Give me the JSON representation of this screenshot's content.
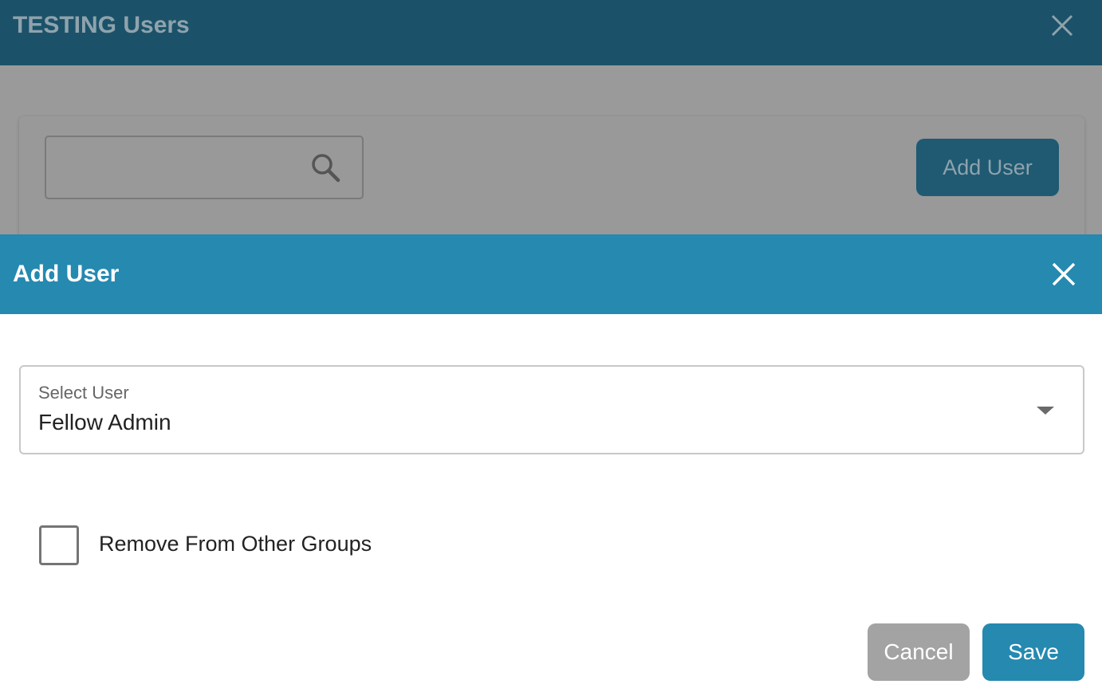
{
  "background": {
    "title": "TESTING Users",
    "close_icon": "close-icon",
    "search": {
      "value": "",
      "icon": "search-icon"
    },
    "add_user_label": "Add User"
  },
  "modal": {
    "title": "Add User",
    "close_icon": "close-icon",
    "select_user": {
      "label": "Select User",
      "value": "Fellow Admin",
      "icon": "caret-down-icon"
    },
    "remove_from_other_groups": {
      "label": "Remove From Other Groups",
      "checked": false
    },
    "cancel_label": "Cancel",
    "save_label": "Save"
  },
  "colors": {
    "app_header": "#1b5269",
    "modal_header": "#2589b0",
    "save_button": "#2589b0",
    "cancel_button": "#a3a3a3",
    "overlay": "#999999"
  }
}
